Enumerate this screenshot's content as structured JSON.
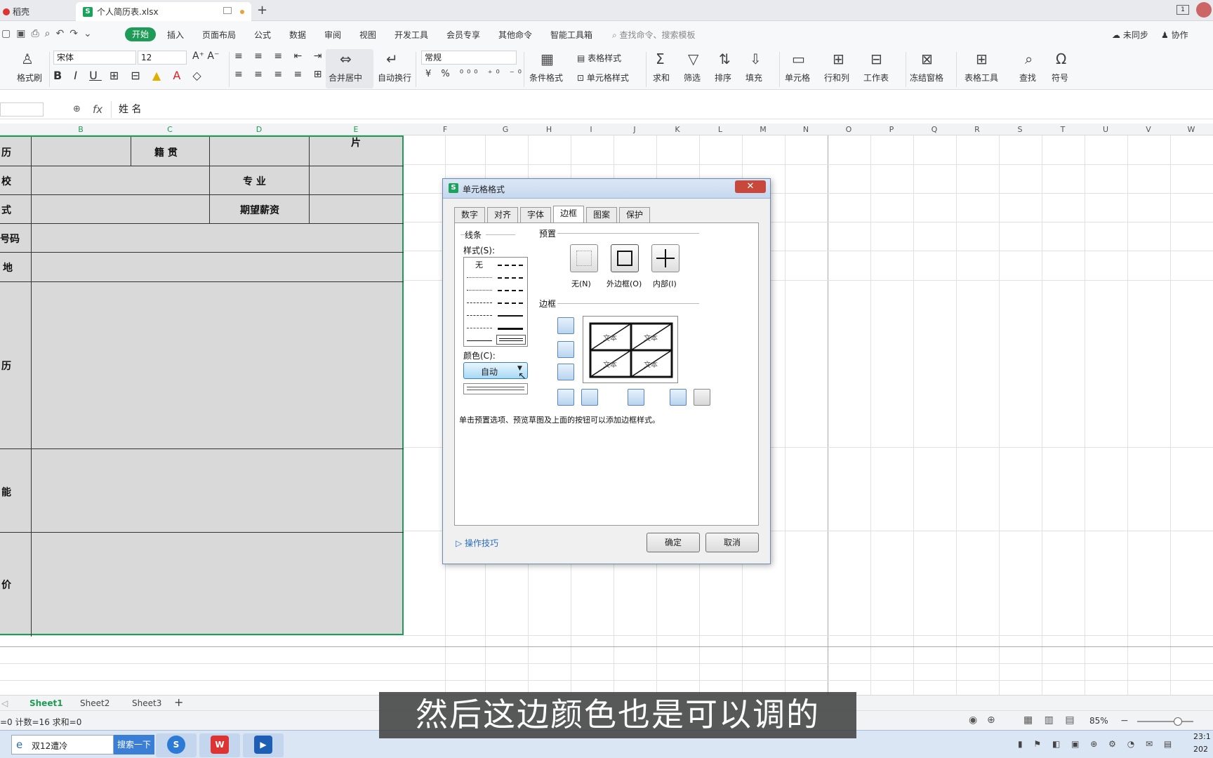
{
  "tabs": [
    {
      "label": "稻壳"
    },
    {
      "label": "个人简历表.xlsx"
    }
  ],
  "tab_add": "+",
  "window_badge": "1",
  "menu": {
    "items": [
      "开始",
      "插入",
      "页面布局",
      "公式",
      "数据",
      "审阅",
      "视图",
      "开发工具",
      "会员专享",
      "其他命令",
      "智能工具箱"
    ],
    "search_placeholder": "查找命令、搜索模板",
    "sync": "未同步",
    "collab": "协作"
  },
  "ribbon": {
    "format_painter": "格式刷",
    "font_name": "宋体",
    "font_size": "12",
    "merge_center": "合并居中",
    "auto_wrap": "自动换行",
    "number_format": "常规",
    "cond_format": "条件格式",
    "table_style": "表格样式",
    "cell_style": "单元格样式",
    "sum": "求和",
    "filter": "筛选",
    "sort": "排序",
    "fill": "填充",
    "cell": "单元格",
    "row_col": "行和列",
    "worksheet": "工作表",
    "freeze": "冻结窗格",
    "table_tools": "表格工具",
    "find": "查找",
    "symbol": "符号"
  },
  "formula_bar": {
    "fx": "fx",
    "content": "姓  名"
  },
  "columns": [
    "B",
    "C",
    "D",
    "E",
    "F",
    "G",
    "H",
    "I",
    "J",
    "K",
    "L",
    "M",
    "N",
    "O",
    "P",
    "Q",
    "R",
    "S",
    "T",
    "U",
    "V",
    "W"
  ],
  "resume": {
    "r1_left": "历",
    "r1_mid": "籍  贯",
    "r1_photo": "片",
    "r2_left": "校",
    "r2_mid": "专  业",
    "r3_left": "式",
    "r3_mid": "期望薪资",
    "r4_left": "号码",
    "r5_left": "地",
    "r6_left": "历",
    "r7_left": "能",
    "r8_left": "价"
  },
  "dialog": {
    "title": "单元格格式",
    "tabs": [
      "数字",
      "对齐",
      "字体",
      "边框",
      "图案",
      "保护"
    ],
    "active_tab": "边框",
    "line_group": "线条",
    "style_label": "样式(S):",
    "style_none": "无",
    "color_label": "颜色(C):",
    "color_value": "自动",
    "preset_group": "预置",
    "presets": [
      "无(N)",
      "外边框(O)",
      "内部(I)"
    ],
    "border_group": "边框",
    "preview_text": "文本",
    "hint": "单击预置选项、预览草图及上面的按钮可以添加边框样式。",
    "tips": "操作技巧",
    "ok": "确定",
    "cancel": "取消"
  },
  "sheets": [
    "Sheet1",
    "Sheet2",
    "Sheet3"
  ],
  "active_sheet": "Sheet1",
  "status": {
    "left": "=0  计数=16  求和=0",
    "zoom": "85%"
  },
  "taskbar": {
    "browser_title": "双12遭冷",
    "search_btn": "搜索一下",
    "time": "23:1",
    "date": "202"
  },
  "subtitle": "然后这边颜色也是可以调的",
  "colors": {
    "accent": "#1e9b56",
    "selection_border": "#1e9b56",
    "cell_fill": "#d9d9d9"
  }
}
